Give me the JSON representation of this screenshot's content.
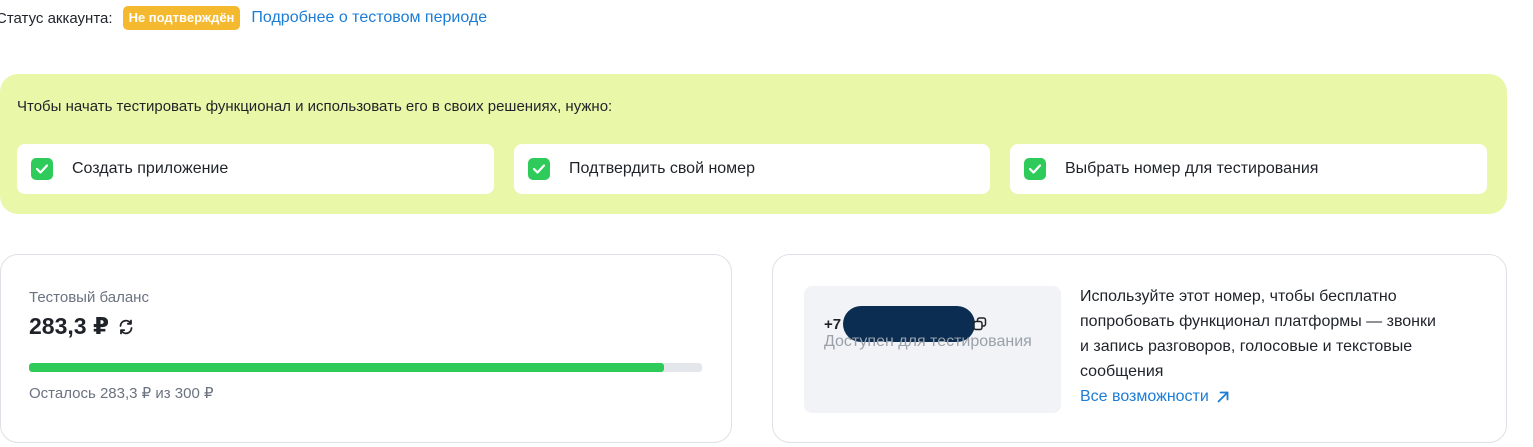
{
  "account": {
    "status_label": "Статус аккаунта:",
    "status_badge": "Не подтверждён",
    "status_badge_color": "#f4b92f",
    "trial_link": "Подробнее о тестовом периоде"
  },
  "onboarding": {
    "background": "#e8f7a8",
    "title": "Чтобы начать тестировать функционал и использовать его в своих решениях, нужно:",
    "steps": [
      {
        "label": "Создать приложение",
        "done": true,
        "icon": "check-icon"
      },
      {
        "label": "Подтвердить свой номер",
        "done": true,
        "icon": "check-icon"
      },
      {
        "label": "Выбрать номер для тестирования",
        "done": true,
        "icon": "check-icon"
      }
    ]
  },
  "balance": {
    "caption": "Тестовый баланс",
    "value": "283,3 ₽",
    "refresh_icon": "refresh-icon",
    "progress_fraction": 0.944,
    "progress_color": "#2ecb5b",
    "remaining": "Осталось 283,3 ₽ из 300 ₽"
  },
  "test_number": {
    "phone_prefix": "+7",
    "copy_icon": "copy-icon",
    "status": "Доступен для тестирования",
    "description": "Используйте этот номер, чтобы бесплатно попробовать функционал платформы — звонки и запись разговоров, голосовые и текстовые сообщения",
    "link": "Все возможности",
    "link_icon": "arrow-up-right-icon"
  },
  "colors": {
    "accent_link": "#1c7cd6",
    "success": "#2ecb5b"
  }
}
